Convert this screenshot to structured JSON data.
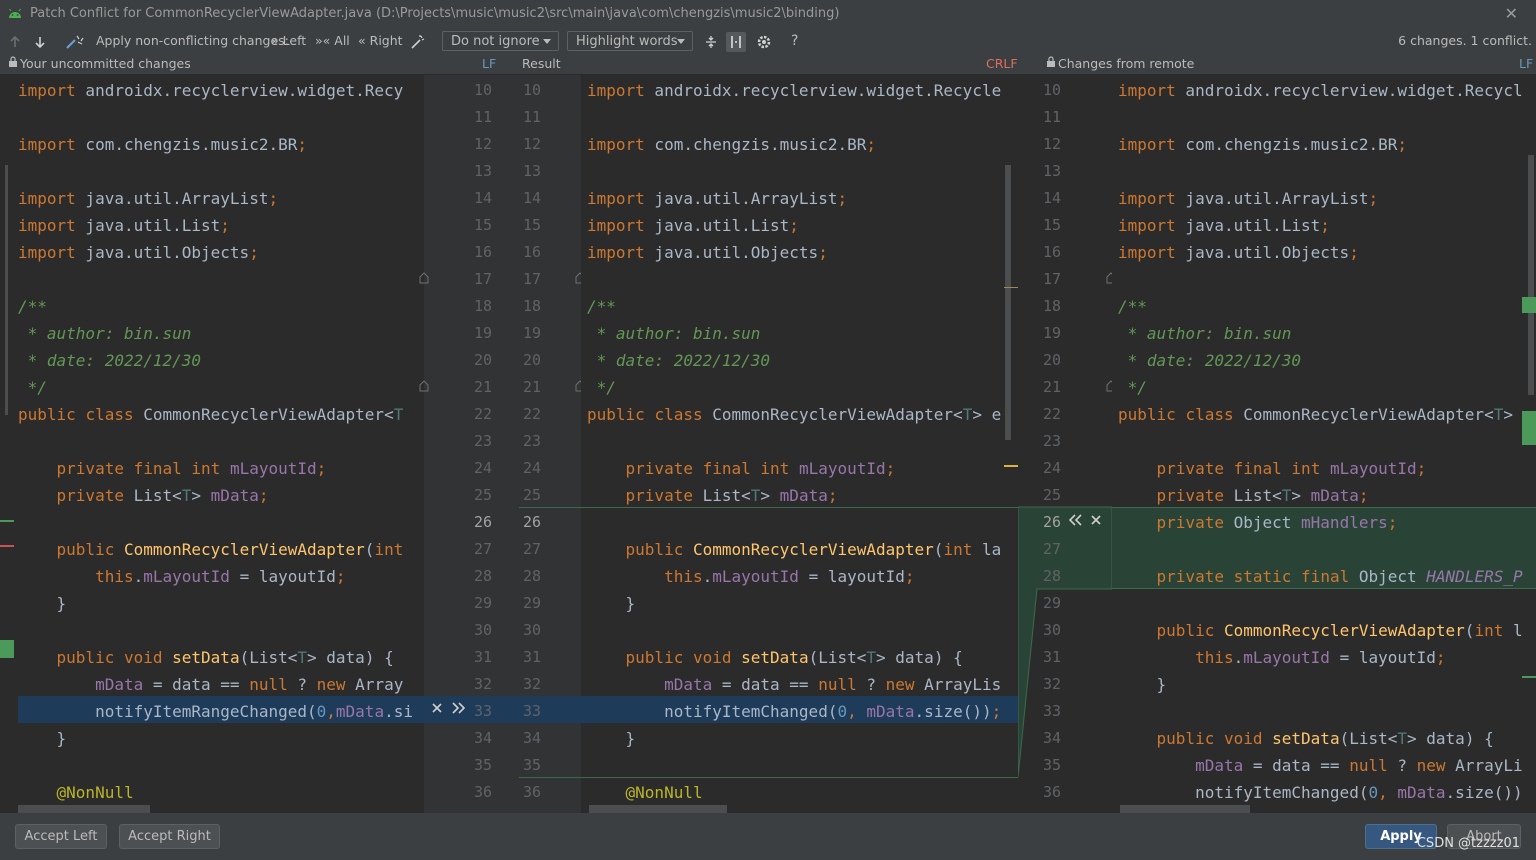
{
  "window": {
    "title": "Patch Conflict for CommonRecyclerViewAdapter.java (D:\\Projects\\music\\music2\\src\\main\\java\\com\\chengzis\\music2\\binding)",
    "close_glyph": "✕"
  },
  "toolbar": {
    "apply_label": "Apply non-conflicting changes:",
    "left_label": "Left",
    "all_label": "All",
    "right_label": "Right",
    "ignore_select": "Do not ignore",
    "highlight_select": "Highlight words",
    "help_glyph": "?",
    "summary": "6 changes. 1 conflict."
  },
  "headers": {
    "left_title": "Your uncommitted changes",
    "left_eol": "LF",
    "center_title": "Result",
    "center_eol": "CRLF",
    "right_title": "Changes from remote",
    "right_eol": "LF"
  },
  "left_lines": [
    "import androidx.recyclerview.widget.Recy",
    "",
    "import com.chengzis.music2.BR;",
    "",
    "import java.util.ArrayList;",
    "import java.util.List;",
    "import java.util.Objects;",
    "",
    "/**",
    " * author: bin.sun",
    " * date: 2022/12/30",
    " */",
    "public class CommonRecyclerViewAdapter<T",
    "",
    "    private final int mLayoutId;",
    "    private List<T> mData;",
    "",
    "    public CommonRecyclerViewAdapter(int",
    "        this.mLayoutId = layoutId;",
    "    }",
    "",
    "    public void setData(List<T> data) {",
    "        mData = data == null ? new Array",
    "        notifyItemRangeChanged(0,mData.si",
    "    }",
    "",
    "    @NonNull"
  ],
  "center_lines": [
    "import androidx.recyclerview.widget.Recycle",
    "",
    "import com.chengzis.music2.BR;",
    "",
    "import java.util.ArrayList;",
    "import java.util.List;",
    "import java.util.Objects;",
    "",
    "/**",
    " * author: bin.sun",
    " * date: 2022/12/30",
    " */",
    "public class CommonRecyclerViewAdapter<T> e",
    "",
    "    private final int mLayoutId;",
    "    private List<T> mData;",
    "",
    "    public CommonRecyclerViewAdapter(int la",
    "        this.mLayoutId = layoutId;",
    "    }",
    "",
    "    public void setData(List<T> data) {",
    "        mData = data == null ? new ArrayLis",
    "        notifyItemChanged(0, mData.size());",
    "    }",
    "",
    "    @NonNull"
  ],
  "right_lines": [
    "import androidx.recyclerview.widget.Recycl",
    "",
    "import com.chengzis.music2.BR;",
    "",
    "import java.util.ArrayList;",
    "import java.util.List;",
    "import java.util.Objects;",
    "",
    "/**",
    " * author: bin.sun",
    " * date: 2022/12/30",
    " */",
    "public class CommonRecyclerViewAdapter<T>",
    "",
    "    private final int mLayoutId;",
    "    private List<T> mData;",
    "    private Object mHandlers;",
    "",
    "    private static final Object HANDLERS_P",
    "",
    "    public CommonRecyclerViewAdapter(int l",
    "        this.mLayoutId = layoutId;",
    "    }",
    "",
    "    public void setData(List<T> data) {",
    "        mData = data == null ? new ArrayLi",
    "        notifyItemChanged(0, mData.size())"
  ],
  "gutter_left_numbers": [
    "10",
    "11",
    "12",
    "13",
    "14",
    "15",
    "16",
    "17",
    "18",
    "19",
    "20",
    "21",
    "22",
    "23",
    "24",
    "25",
    "26",
    "27",
    "28",
    "29",
    "30",
    "31",
    "32",
    "33",
    "34",
    "35",
    "36"
  ],
  "gutter_center_numbers": [
    "10",
    "11",
    "12",
    "13",
    "14",
    "15",
    "16",
    "17",
    "18",
    "19",
    "20",
    "21",
    "22",
    "23",
    "24",
    "25",
    "26",
    "27",
    "28",
    "29",
    "30",
    "31",
    "32",
    "33",
    "34",
    "35",
    "36"
  ],
  "gutter_right_numbers": [
    "10",
    "11",
    "12",
    "13",
    "14",
    "15",
    "16",
    "17",
    "18",
    "19",
    "20",
    "21",
    "22",
    "23",
    "24",
    "25",
    "26",
    "27",
    "28",
    "29",
    "30",
    "31",
    "32",
    "33",
    "34",
    "35",
    "36"
  ],
  "footer": {
    "accept_left": "Accept Left",
    "accept_right": "Accept Right",
    "apply": "Apply",
    "abort": "Abort",
    "watermark": "CSDN @tzzzz01"
  },
  "colors": {
    "conflict_bg": "#1f3b5a",
    "insert_bg": "#294436",
    "accent": "#365880"
  }
}
